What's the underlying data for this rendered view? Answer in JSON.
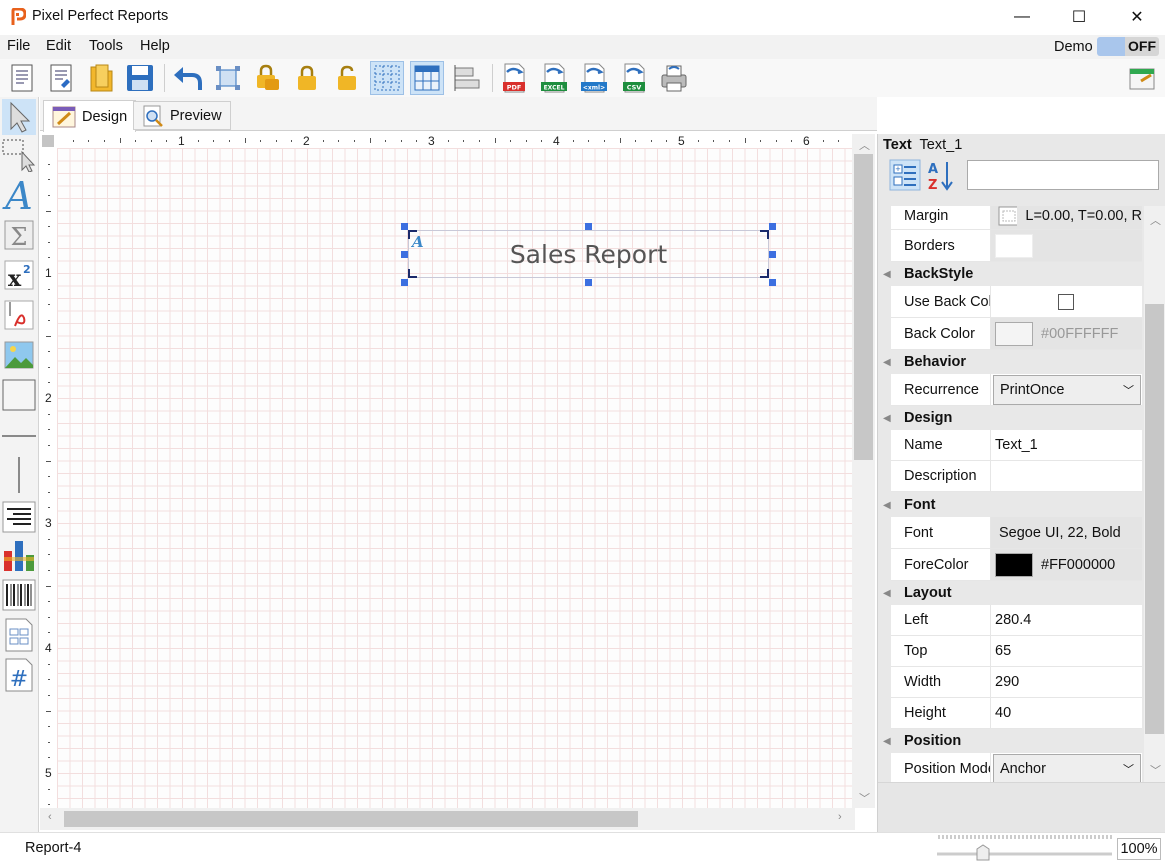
{
  "app": {
    "title": "Pixel Perfect Reports"
  },
  "window_controls": {
    "minimize": "—",
    "maximize": "☐",
    "close": "✕"
  },
  "menu": [
    "File",
    "Edit",
    "Tools",
    "Help"
  ],
  "demo": {
    "label": "Demo",
    "state": "OFF"
  },
  "toolbar": {
    "buttons": [
      "new-report",
      "report-wizard",
      "open",
      "save",
      "undo",
      "fit-selection",
      "lock-all",
      "lock",
      "unlock",
      "show-grid",
      "snap-to-grid",
      "align",
      "export-pdf",
      "export-excel",
      "export-xml",
      "export-csv",
      "print",
      "close-report"
    ],
    "export_labels": {
      "pdf": "PDF",
      "excel": "EXCEL",
      "xml": "<xml>",
      "csv": "CSV"
    }
  },
  "tabs": [
    {
      "label": "Design",
      "active": true
    },
    {
      "label": "Preview",
      "active": false
    }
  ],
  "ruler": {
    "h": [
      "1",
      "2",
      "3",
      "4",
      "5",
      "6"
    ],
    "v": [
      "1",
      "2",
      "3",
      "4",
      "5"
    ]
  },
  "report_element": {
    "text": "Sales Report"
  },
  "properties": {
    "object_type": "Text",
    "object_name": "Text_1",
    "search_value": "",
    "rows": {
      "margin": {
        "name": "Margin",
        "value": "L=0.00, T=0.00, R"
      },
      "borders": {
        "name": "Borders"
      },
      "backstyle": "BackStyle",
      "use_back_color": {
        "name": "Use Back Color"
      },
      "back_color": {
        "name": "Back Color",
        "value": "#00FFFFFF"
      },
      "behavior": "Behavior",
      "recurrence": {
        "name": "Recurrence",
        "value": "PrintOnce"
      },
      "design": "Design",
      "name": {
        "name": "Name",
        "value": "Text_1"
      },
      "description": {
        "name": "Description",
        "value": ""
      },
      "font_cat": "Font",
      "font": {
        "name": "Font",
        "value": "Segoe UI, 22, Bold"
      },
      "forecolor": {
        "name": "ForeColor",
        "value": "#FF000000"
      },
      "layout": "Layout",
      "left": {
        "name": "Left",
        "value": "280.4"
      },
      "top": {
        "name": "Top",
        "value": "65"
      },
      "width": {
        "name": "Width",
        "value": "290"
      },
      "height": {
        "name": "Height",
        "value": "40"
      },
      "position": "Position",
      "position_mode": {
        "name": "Position Mode",
        "value": "Anchor"
      }
    }
  },
  "status": {
    "text": "Report-4",
    "zoom": "100%"
  },
  "colors": {
    "accent": "#3c6fe0",
    "grid": "#f3dede",
    "selection_bg": "#cde3f7"
  }
}
